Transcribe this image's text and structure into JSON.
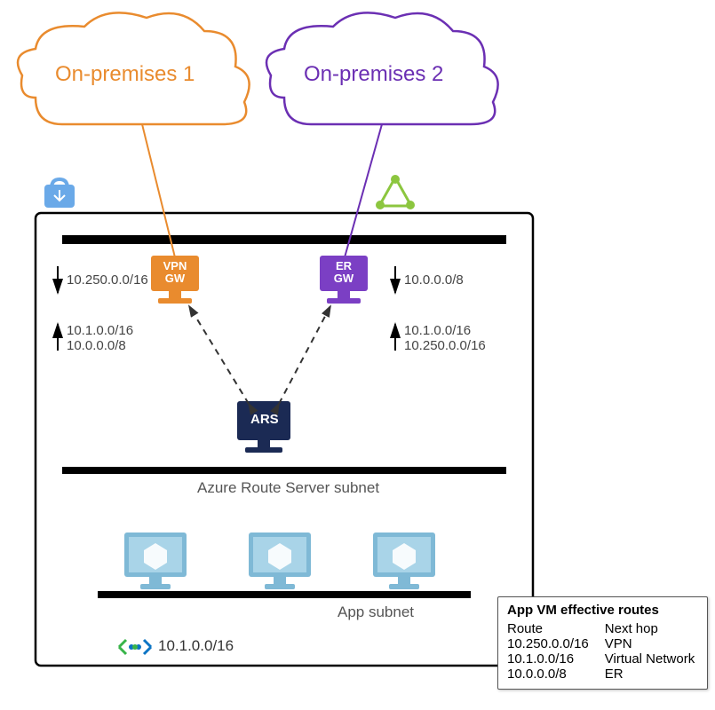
{
  "clouds": {
    "onprem1": {
      "label": "On-premises 1",
      "color": "#e98b2e"
    },
    "onprem2": {
      "label": "On-premises 2",
      "color": "#6b2fb3"
    }
  },
  "gateways": {
    "vpn": {
      "label_l1": "VPN",
      "label_l2": "GW",
      "fill": "#e98b2e"
    },
    "er": {
      "label_l1": "ER",
      "label_l2": "GW",
      "fill": "#7b3fc4"
    },
    "ars": {
      "label": "ARS",
      "fill": "#1b2a54"
    }
  },
  "routes": {
    "left_in": "10.250.0.0/16",
    "left_out_1": "10.1.0.0/16",
    "left_out_2": "10.0.0.0/8",
    "right_in": "10.0.0.0/8",
    "right_out_1": "10.1.0.0/16",
    "right_out_2": "10.250.0.0/16"
  },
  "subnets": {
    "ars": "Azure Route Server subnet",
    "app": "App subnet"
  },
  "vnet": {
    "address": "10.1.0.0/16"
  },
  "effective_routes": {
    "title": "App VM effective routes",
    "col1": "Route",
    "col2": "Next hop",
    "rows": [
      {
        "route": "10.250.0.0/16",
        "hop": "VPN"
      },
      {
        "route": "10.1.0.0/16",
        "hop": "Virtual Network"
      },
      {
        "route": "10.0.0.0/8",
        "hop": "ER"
      }
    ]
  },
  "icons": {
    "vpn_badge": "vpn-lock-icon",
    "er_badge": "expressroute-icon",
    "vnet": "vnet-peering-icon",
    "vm": "vm-icon"
  }
}
